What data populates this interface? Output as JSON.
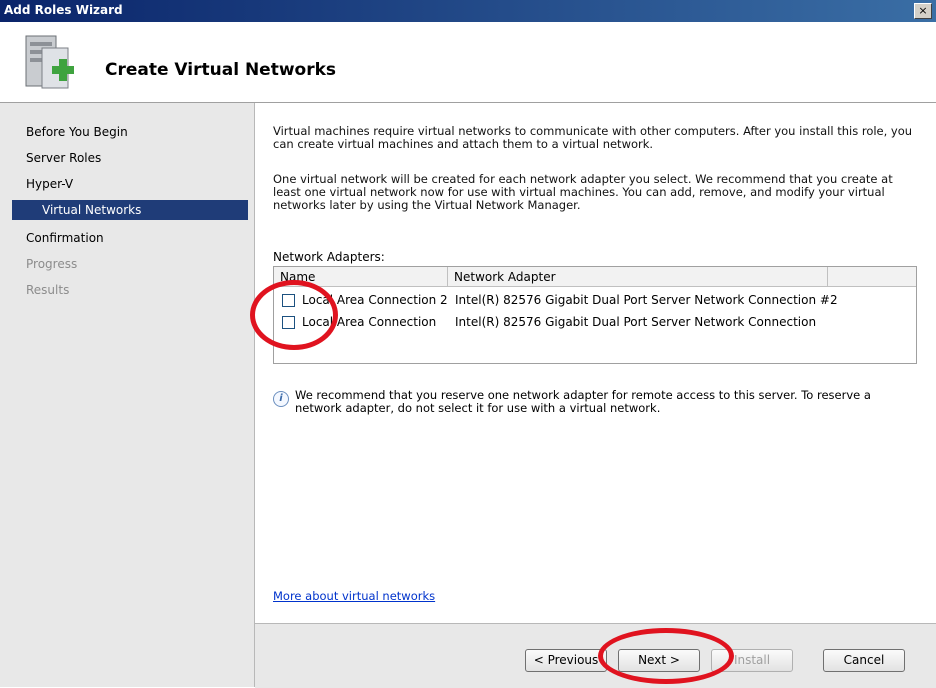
{
  "window": {
    "title": "Add Roles Wizard",
    "close_glyph": "×"
  },
  "header": {
    "title": "Create Virtual Networks"
  },
  "sidebar": {
    "items": [
      {
        "label": "Before You Begin",
        "state": "normal"
      },
      {
        "label": "Server Roles",
        "state": "normal"
      },
      {
        "label": "Hyper-V",
        "state": "normal"
      },
      {
        "label": "Virtual Networks",
        "state": "selected"
      },
      {
        "label": "Confirmation",
        "state": "normal"
      },
      {
        "label": "Progress",
        "state": "disabled"
      },
      {
        "label": "Results",
        "state": "disabled"
      }
    ]
  },
  "main": {
    "intro_1": "Virtual machines require virtual networks to communicate with other computers. After you install this role, you can create virtual machines and attach them to a virtual network.",
    "intro_2": "One virtual network will be created for each network adapter you select. We recommend that you create at least one virtual network now for use with virtual machines. You can add, remove, and modify your virtual networks later by using the Virtual Network Manager.",
    "adapters_label": "Network Adapters:",
    "columns": [
      "Name",
      "Network Adapter"
    ],
    "rows": [
      {
        "name": "Local Area Connection 2",
        "adapter": "Intel(R) 82576 Gigabit Dual Port Server Network Connection #2",
        "checked": false
      },
      {
        "name": "Local Area Connection",
        "adapter": "Intel(R) 82576 Gigabit Dual Port Server Network Connection",
        "checked": false
      }
    ],
    "info_text": "We recommend that you reserve one network adapter for remote access to this server. To reserve a network adapter, do not select it for use with a virtual network.",
    "more_link": "More about virtual networks"
  },
  "footer": {
    "previous": "< Previous",
    "next": "Next >",
    "install": "Install",
    "cancel": "Cancel"
  },
  "colors": {
    "annotation": "#e0131f",
    "selected_nav": "#1f3c78",
    "title_bar": "#0a246a"
  }
}
